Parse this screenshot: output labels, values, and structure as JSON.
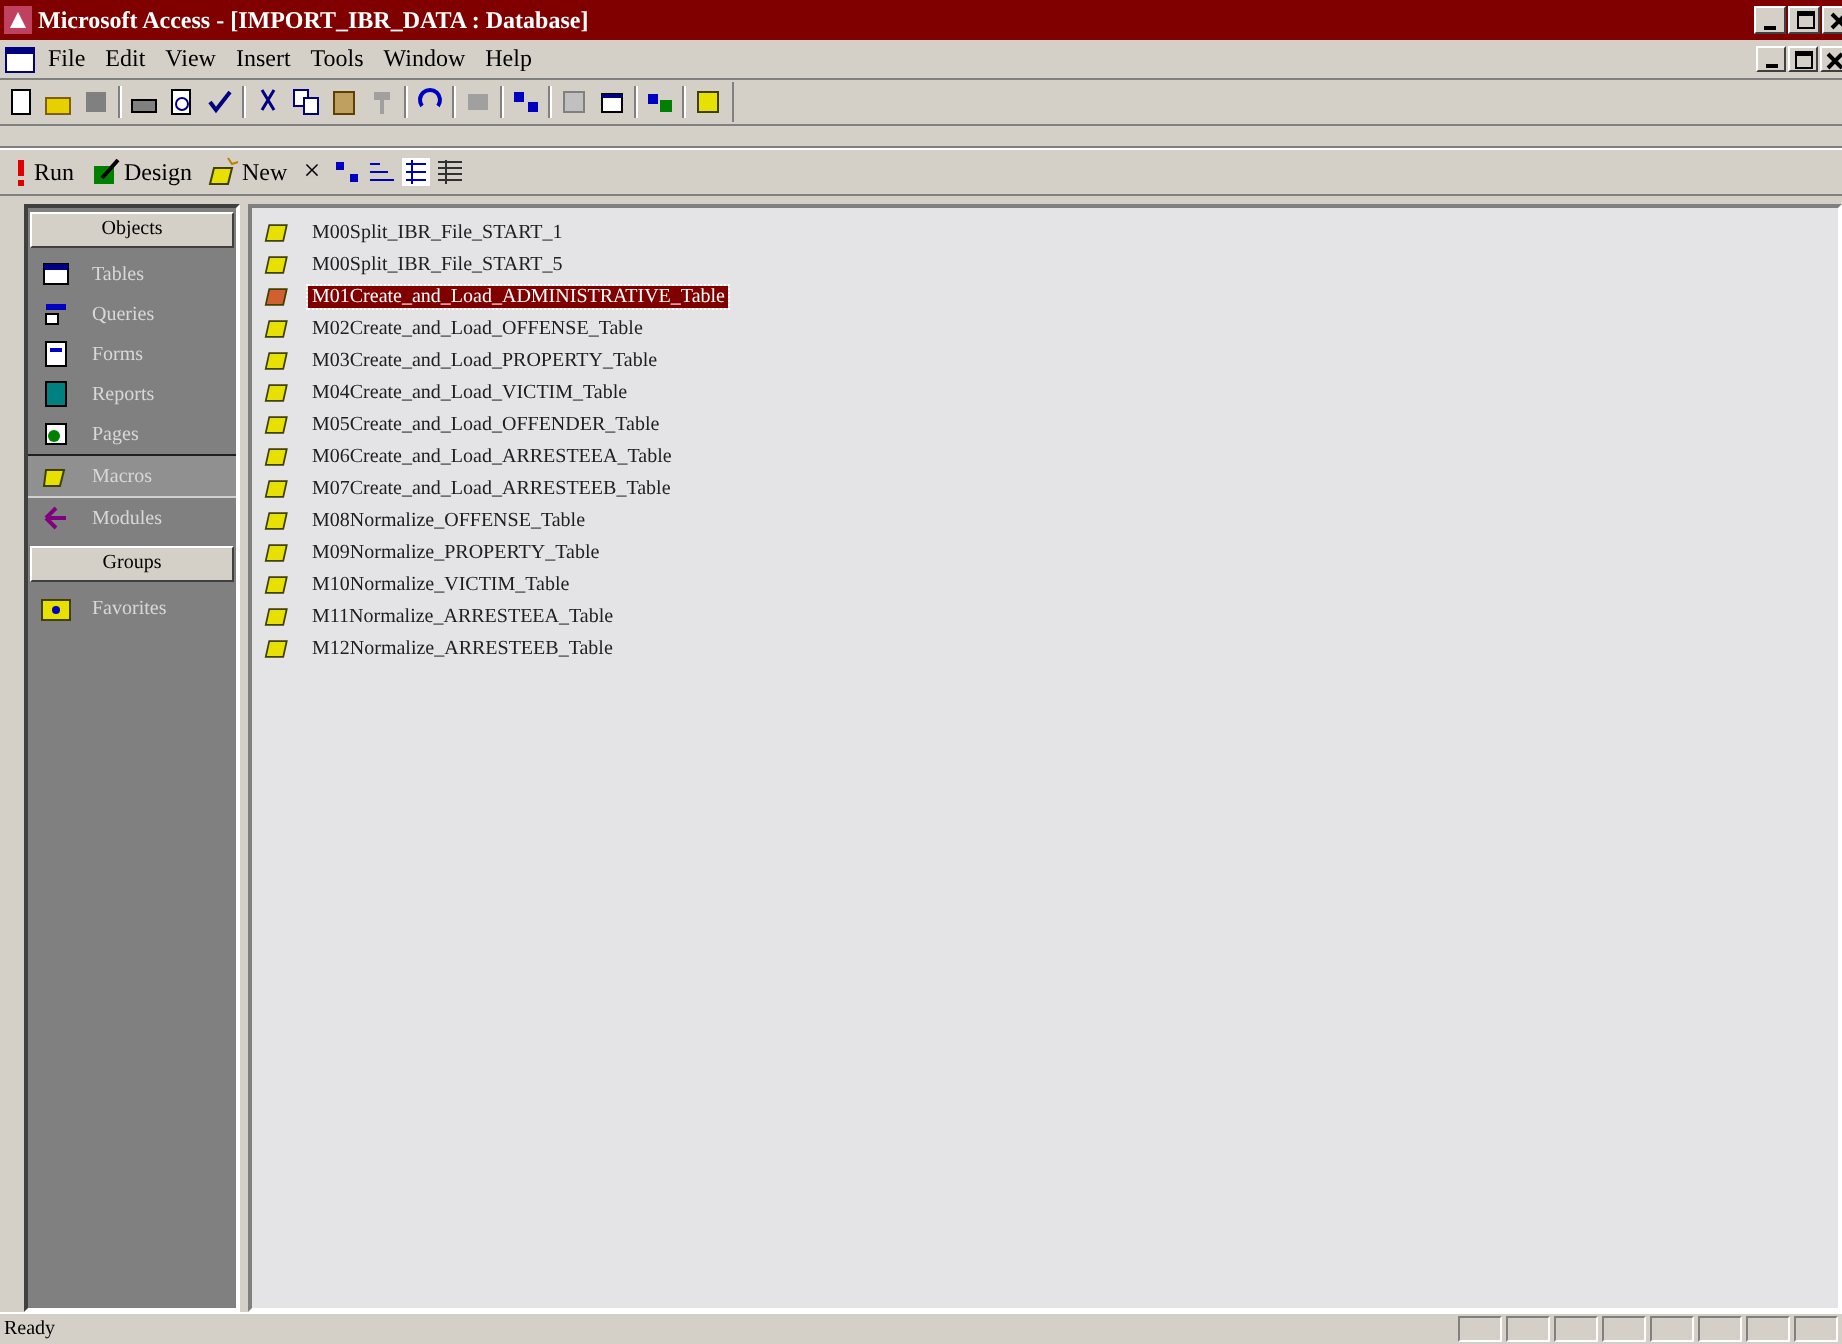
{
  "window": {
    "title": "Microsoft Access - [IMPORT_IBR_DATA : Database]"
  },
  "menu": [
    "File",
    "Edit",
    "View",
    "Insert",
    "Tools",
    "Window",
    "Help"
  ],
  "db_toolbar": [
    {
      "kind": "run",
      "label": "Run"
    },
    {
      "kind": "design",
      "label": "Design"
    },
    {
      "kind": "new",
      "label": "New"
    },
    {
      "kind": "delete",
      "label": "×"
    }
  ],
  "sidebar": {
    "objects_header": "Objects",
    "items": [
      {
        "kind": "tables",
        "label": "Tables",
        "selected": false
      },
      {
        "kind": "queries",
        "label": "Queries",
        "selected": false
      },
      {
        "kind": "forms",
        "label": "Forms",
        "selected": false
      },
      {
        "kind": "reports",
        "label": "Reports",
        "selected": false
      },
      {
        "kind": "pages",
        "label": "Pages",
        "selected": false
      },
      {
        "kind": "macros",
        "label": "Macros",
        "selected": true
      },
      {
        "kind": "modules",
        "label": "Modules",
        "selected": false
      }
    ],
    "groups_header": "Groups",
    "groups": [
      {
        "label": "Favorites"
      }
    ]
  },
  "macros": [
    {
      "name": "M00Split_IBR_File_START_1",
      "selected": false
    },
    {
      "name": "M00Split_IBR_File_START_5",
      "selected": false
    },
    {
      "name": "M01Create_and_Load_ADMINISTRATIVE_Table",
      "selected": true
    },
    {
      "name": "M02Create_and_Load_OFFENSE_Table",
      "selected": false
    },
    {
      "name": "M03Create_and_Load_PROPERTY_Table",
      "selected": false
    },
    {
      "name": "M04Create_and_Load_VICTIM_Table",
      "selected": false
    },
    {
      "name": "M05Create_and_Load_OFFENDER_Table",
      "selected": false
    },
    {
      "name": "M06Create_and_Load_ARRESTEEA_Table",
      "selected": false
    },
    {
      "name": "M07Create_and_Load_ARRESTEEB_Table",
      "selected": false
    },
    {
      "name": "M08Normalize_OFFENSE_Table",
      "selected": false
    },
    {
      "name": "M09Normalize_PROPERTY_Table",
      "selected": false
    },
    {
      "name": "M10Normalize_VICTIM_Table",
      "selected": false
    },
    {
      "name": "M11Normalize_ARRESTEEA_Table",
      "selected": false
    },
    {
      "name": "M12Normalize_ARRESTEEB_Table",
      "selected": false
    }
  ],
  "status_bar": {
    "text": "Ready"
  }
}
